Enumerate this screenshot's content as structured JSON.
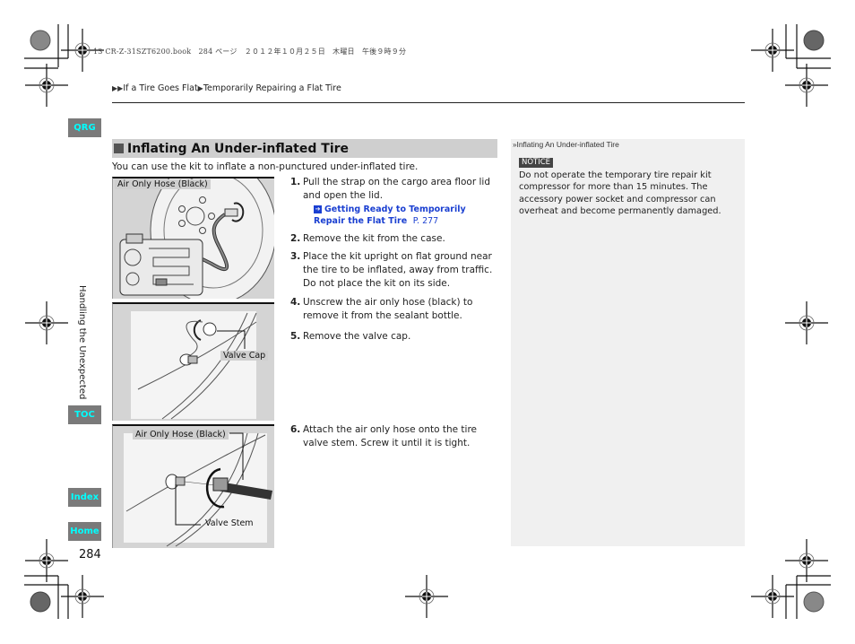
{
  "print_header": "13 CR-Z-31SZT6200.book　284 ページ　２０１２年１０月２５日　木曜日　午後９時９分",
  "breadcrumb": {
    "items": [
      "If a Tire Goes Flat",
      "Temporarily Repairing a Flat Tire"
    ]
  },
  "nav": {
    "qrg": "QRG",
    "toc": "TOC",
    "index": "Index",
    "home": "Home"
  },
  "chapter_label": "Handling the Unexpected",
  "page_number": "284",
  "section": {
    "title": "Inflating An Under-inflated Tire",
    "intro": "You can use the kit to inflate a non-punctured under-inflated tire."
  },
  "figures": [
    {
      "labels": [
        "Air Only Hose (Black)"
      ]
    },
    {
      "labels": [
        "Valve Cap"
      ]
    },
    {
      "labels": [
        "Air Only Hose (Black)",
        "Valve Stem"
      ]
    }
  ],
  "steps": [
    {
      "num": "1.",
      "text": "Pull the strap on the cargo area floor lid and open the lid.",
      "xref": {
        "text": "Getting Ready to Temporarily Repair the Flat Tire",
        "page": "P. 277"
      }
    },
    {
      "num": "2.",
      "text": "Remove the kit from the case."
    },
    {
      "num": "3.",
      "text": "Place the kit upright on flat ground near the tire to be inflated, away from traffic. Do not place the kit on its side."
    },
    {
      "num": "4.",
      "text": "Unscrew the air only hose (black) to remove it from the sealant bottle."
    },
    {
      "num": "5.",
      "text": "Remove the valve cap."
    },
    {
      "num": "6.",
      "text": "Attach the air only hose onto the tire valve stem. Screw it until it is tight."
    }
  ],
  "sidebar": {
    "title": "Inflating An Under-inflated Tire",
    "notice_label": "NOTICE",
    "notice_text": "Do not operate the temporary tire repair kit compressor for more than 15 minutes. The accessory power socket and compressor can overheat and become permanently damaged."
  },
  "colors": {
    "nav_bg": "#7a7a7a",
    "nav_text": "#00ffff",
    "link": "#1a3fd1",
    "section_bar": "#cfcfcf"
  }
}
